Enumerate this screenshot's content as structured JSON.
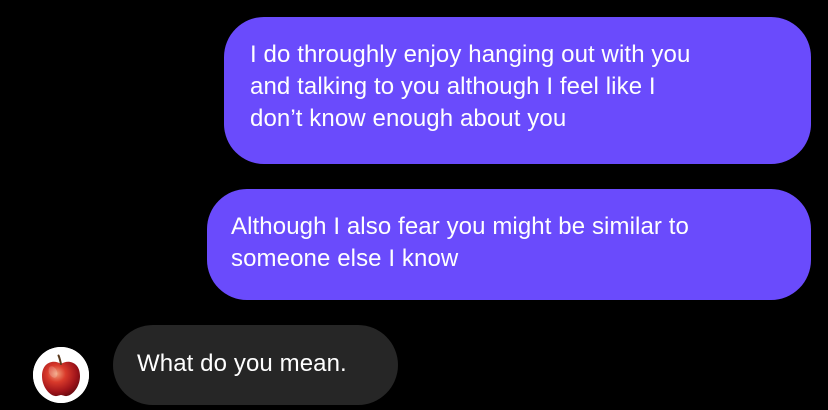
{
  "thread": {
    "messages": [
      {
        "direction": "outgoing",
        "text": "I do throughly enjoy hanging out with you\nand talking to you although I feel like I\ndon’t know enough about you"
      },
      {
        "direction": "outgoing",
        "text": "Although I also fear you might be similar to\nsomeone else I know"
      },
      {
        "direction": "incoming",
        "text": "What do you mean."
      }
    ],
    "contact": {
      "avatar_icon": "apple-icon"
    }
  },
  "colors": {
    "background": "#000000",
    "outgoing_bubble": "#6a4bfc",
    "incoming_bubble": "#262626",
    "text": "#ffffff"
  }
}
